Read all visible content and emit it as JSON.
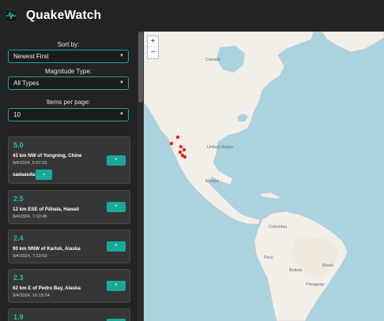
{
  "app": {
    "title": "QuakeWatch",
    "logo_icon": "seismograph-icon"
  },
  "filters": {
    "sort_label": "Sort by:",
    "sort_value": "Newest First",
    "type_label": "Magnitude Type:",
    "type_value": "All Types",
    "per_page_label": "Items per page:",
    "per_page_value": "10"
  },
  "quakes": [
    {
      "mag": "5.0",
      "place": "43 km NW of Yongning, Chine",
      "time": "9/4/2024, 5:07:03",
      "extra": "sadaasdas"
    },
    {
      "mag": "2.5",
      "place": "12 km ESE of Pāhala, Hawaii",
      "time": "9/4/2024, 7:10:45"
    },
    {
      "mag": "2.4",
      "place": "90 km NNW of Karluk, Alaska",
      "time": "9/4/2024, 7:23:03"
    },
    {
      "mag": "2.3",
      "place": "62 km E of Pedro Bay, Alaska",
      "time": "9/4/2024, 10:15:24"
    },
    {
      "mag": "1.9"
    }
  ],
  "map": {
    "zoom_in": "+",
    "zoom_out": "−",
    "labels": {
      "canada": "Canada",
      "us": "United States",
      "mexico": "México",
      "colombia": "Colombia",
      "peru": "Perú",
      "brasil": "Brasil",
      "bolivia": "Bolivia",
      "paraguay": "Paraguay"
    },
    "marker_color": "#e8231f"
  }
}
